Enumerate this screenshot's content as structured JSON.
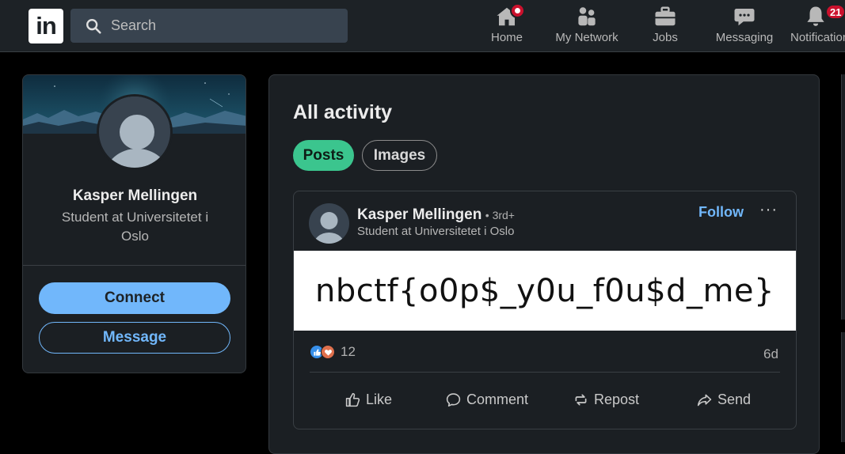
{
  "app": {
    "logo_text": "in",
    "accent_color": "#71b7fb",
    "green_accent": "#3bc58e"
  },
  "search": {
    "placeholder": "Search"
  },
  "nav": {
    "home": "Home",
    "network": "My Network",
    "jobs": "Jobs",
    "messaging": "Messaging",
    "notifications": "Notifications",
    "notifications_count": "21"
  },
  "profile": {
    "name": "Kasper Mellingen",
    "headline": "Student at Universitetet i Oslo",
    "connect_label": "Connect",
    "message_label": "Message"
  },
  "activity": {
    "title": "All activity",
    "tabs": [
      {
        "label": "Posts",
        "selected": true
      },
      {
        "label": "Images",
        "selected": false
      }
    ]
  },
  "post": {
    "author": "Kasper Mellingen",
    "degree": "• 3rd+",
    "headline": "Student at Universitetet i Oslo",
    "follow_label": "Follow",
    "more_label": "···",
    "image_text": "nbctf{o0p$_y0u_f0u$d_me}",
    "reaction_count": "12",
    "age": "6d",
    "actions": {
      "like": "Like",
      "comment": "Comment",
      "repost": "Repost",
      "send": "Send"
    }
  }
}
